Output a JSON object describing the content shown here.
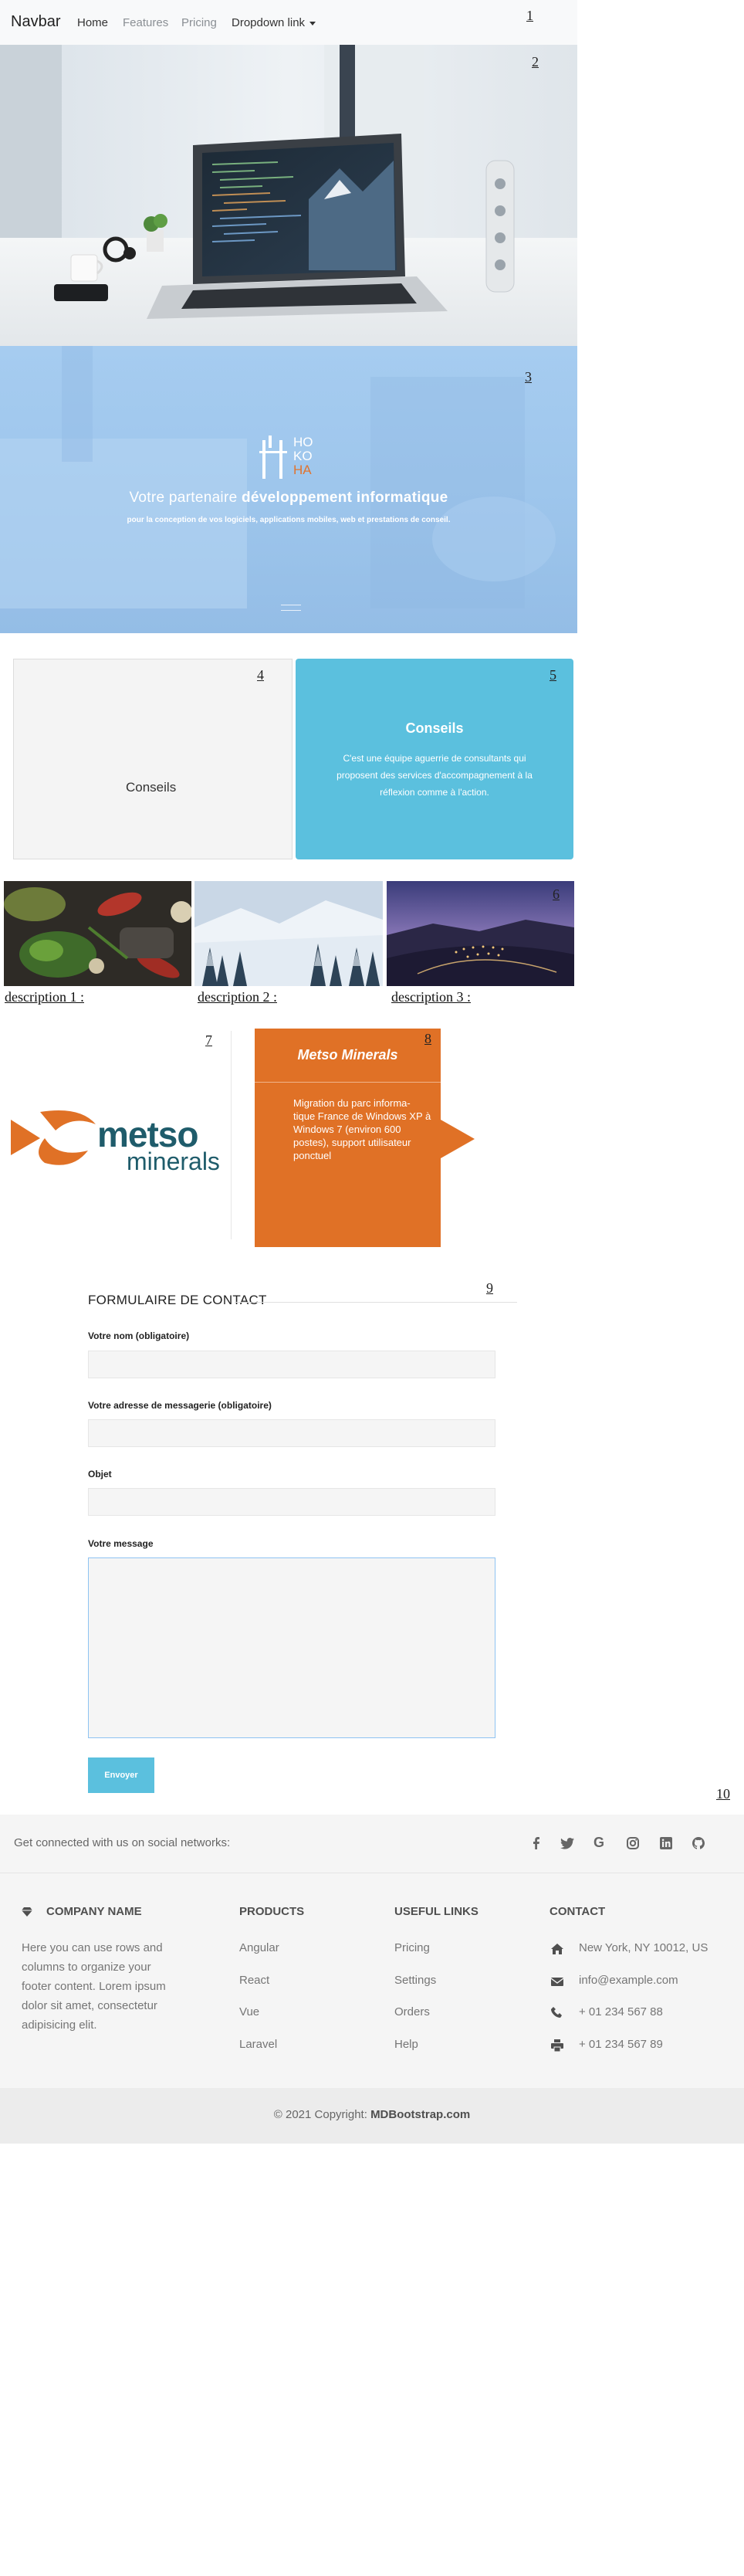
{
  "navbar": {
    "brand": "Navbar",
    "links": [
      "Home",
      "Features",
      "Pricing"
    ],
    "dropdown": "Dropdown link",
    "section_number": "1"
  },
  "hero": {
    "section_number": "2"
  },
  "banner": {
    "section_number": "3",
    "logo_letters": [
      "HO",
      "KO",
      "HA"
    ],
    "tagline_light": "Votre partenaire ",
    "tagline_bold": "développement informatique",
    "subtitle": "pour la conception de vos logiciels, applications mobiles, web et prestations de conseil."
  },
  "cards": {
    "left_number": "4",
    "left_title": "Conseils",
    "right_number": "5",
    "right_title": "Conseils",
    "right_text": "C'est une équipe aguerrie de consultants qui proposent des services d'accompagnement à la réflexion comme à l'action."
  },
  "gallery": {
    "section_number": "6",
    "captions": [
      "description 1 :",
      "description 2 :",
      "description 3 :"
    ]
  },
  "metso": {
    "left_number": "7",
    "right_number": "8",
    "logo_word1": "metso",
    "logo_word2": "minerals",
    "card_title": "Metso Minerals",
    "card_text_lines": [
      "Migration du parc informa-",
      "tique France de Windows XP à",
      "Windows 7 (environ 600",
      "postes), support utilisateur",
      "ponctuel"
    ]
  },
  "form": {
    "section_number": "9",
    "title": "FORMULAIRE DE CONTACT",
    "name_label": "Votre nom (obligatoire)",
    "email_label": "Votre adresse de messagerie (obligatoire)",
    "subject_label": "Objet",
    "message_label": "Votre message",
    "submit": "Envoyer"
  },
  "footer": {
    "section_number": "10",
    "social_text": "Get connected with us on social networks:",
    "social_icons": [
      "facebook-icon",
      "twitter-icon",
      "google-icon",
      "instagram-icon",
      "linkedin-icon",
      "github-icon"
    ],
    "company_title": "COMPANY NAME",
    "company_text_lines": [
      "Here you can use rows and",
      "columns to organize your",
      "footer content. Lorem ipsum",
      "dolor sit amet, consectetur",
      "adipisicing elit."
    ],
    "products_title": "PRODUCTS",
    "products": [
      "Angular",
      "React",
      "Vue",
      "Laravel"
    ],
    "useful_title": "USEFUL LINKS",
    "useful": [
      "Pricing",
      "Settings",
      "Orders",
      "Help"
    ],
    "contact_title": "CONTACT",
    "contact": [
      "New York, NY 10012, US",
      "info@example.com",
      "+ 01 234 567 88",
      "+ 01 234 567 89"
    ],
    "copyright_prefix": "© 2021 Copyright: ",
    "copyright_link": "MDBootstrap.com"
  },
  "colors": {
    "navbar_bg": "#f8f9fa",
    "banner_blue": "#a6ccf0",
    "card_blue": "#5bc0de",
    "metso_orange": "#e07126",
    "metso_teal": "#1f5c6b",
    "footer_bg": "#f5f5f5"
  }
}
